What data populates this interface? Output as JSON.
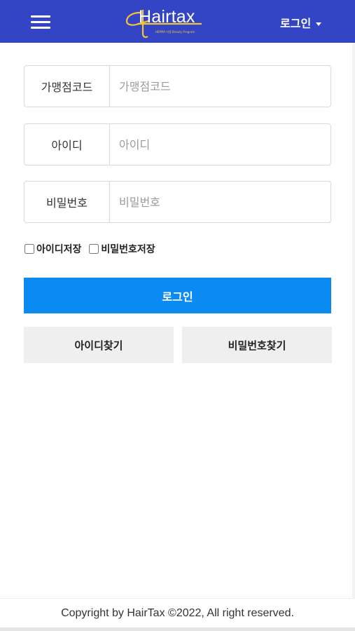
{
  "header": {
    "logo_text": "Hairtax",
    "logo_sub": "HEPMA 미용 Beauty Program",
    "login_menu_label": "로그인",
    "brand_color": "#3344c4",
    "accent_color": "#f3c53a"
  },
  "form": {
    "franchise": {
      "label": "가맹점코드",
      "placeholder": "가맹점코드",
      "value": ""
    },
    "user_id": {
      "label": "아이디",
      "placeholder": "아이디",
      "value": ""
    },
    "password": {
      "label": "비밀번호",
      "placeholder": "비밀번호",
      "value": ""
    },
    "save_id_label": "아이디저장",
    "save_pw_label": "비밀번호저장",
    "login_label": "로그인",
    "find_id_label": "아이디찾기",
    "find_pw_label": "비밀번호찾기",
    "primary_color": "#0b8af1"
  },
  "footer": {
    "copyright": "Copyright by HairTax ©2022, All right reserved."
  },
  "icons": [
    "hamburger-menu-icon",
    "caret-down-icon",
    "logo-icon"
  ]
}
